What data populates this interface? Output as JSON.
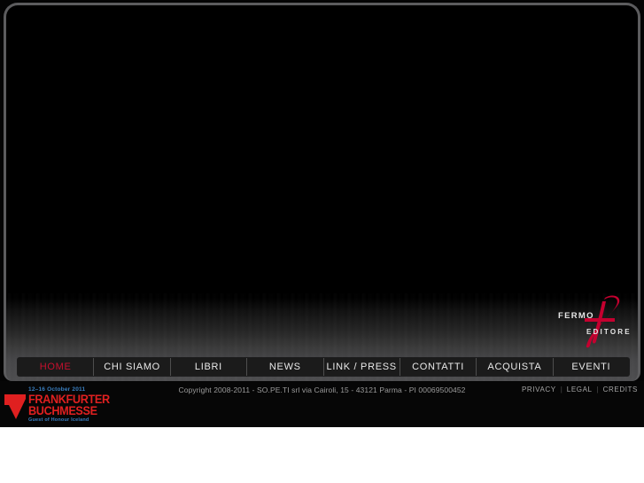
{
  "site": {
    "brand": {
      "name_part1": "FERMO",
      "name_part2": "EDITORE",
      "monogram": "f",
      "accent_color": "#c4002f"
    }
  },
  "nav": {
    "items": [
      {
        "label": "HOME",
        "active": true
      },
      {
        "label": "CHI SIAMO",
        "active": false
      },
      {
        "label": "LIBRI",
        "active": false
      },
      {
        "label": "NEWS",
        "active": false
      },
      {
        "label": "LINK / PRESS",
        "active": false
      },
      {
        "label": "CONTATTI",
        "active": false
      },
      {
        "label": "ACQUISTA",
        "active": false
      },
      {
        "label": "EVENTI",
        "active": false
      }
    ],
    "active_color": "#c8102e",
    "text_color": "#e9e9e9"
  },
  "footer": {
    "fair_badge": {
      "date": "12–16 October 2011",
      "line1": "FRANKFURTER",
      "line2": "BUCHMESSE",
      "guest": "Guest of Honour Iceland",
      "date_color": "#3a7fc1",
      "title_color": "#e02020"
    },
    "copyright": "Copyright 2008-2011 - SO.PE.TI srl via Cairoli, 15 - 43121 Parma - PI 00069500452",
    "legal_links": [
      {
        "label": "PRIVACY"
      },
      {
        "label": "LEGAL"
      },
      {
        "label": "CREDITS"
      }
    ],
    "separator": "|"
  }
}
